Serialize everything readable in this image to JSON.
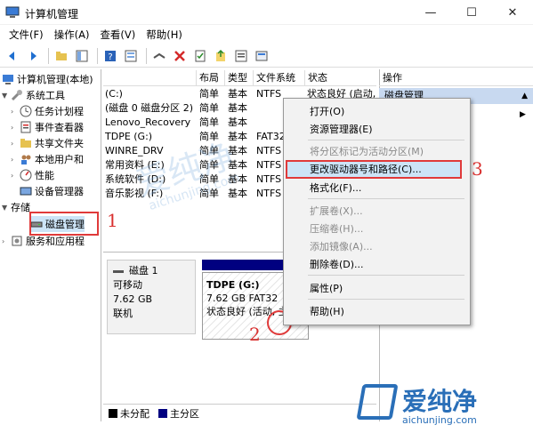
{
  "window": {
    "title": "计算机管理",
    "controls": {
      "minimize": "—",
      "maximize": "☐",
      "close": "✕"
    }
  },
  "menubar": [
    "文件(F)",
    "操作(A)",
    "查看(V)",
    "帮助(H)"
  ],
  "toolbar": {
    "icons": [
      "back-icon",
      "forward-icon",
      "folder-up-icon",
      "show-tree-icon",
      "help-icon",
      "properties-icon",
      "connect-icon",
      "delete-icon",
      "checklist-icon",
      "export-icon",
      "search-icon",
      "zoom-icon"
    ]
  },
  "tree": {
    "root": "计算机管理(本地)",
    "system_tools": "系统工具",
    "task_scheduler": "任务计划程",
    "event_viewer": "事件查看器",
    "shared_folders": "共享文件夹",
    "local_users": "本地用户和",
    "performance": "性能",
    "device_manager": "设备管理器",
    "storage": "存储",
    "disk_management": "磁盘管理",
    "services": "服务和应用程"
  },
  "volume_table": {
    "headers": {
      "layout": "布局",
      "type": "类型",
      "fs": "文件系统",
      "status": "状态"
    },
    "rows": [
      {
        "name": "(C:)",
        "layout": "简单",
        "type": "基本",
        "fs": "NTFS",
        "status": "状态良好 (启动,"
      },
      {
        "name": "(磁盘 0 磁盘分区 2)",
        "layout": "简单",
        "type": "基本",
        "fs": "",
        "status": ""
      },
      {
        "name": "Lenovo_Recovery",
        "layout": "简单",
        "type": "基本",
        "fs": "",
        "status": ""
      },
      {
        "name": "TDPE (G:)",
        "layout": "简单",
        "type": "基本",
        "fs": "FAT32",
        "status": ""
      },
      {
        "name": "WINRE_DRV",
        "layout": "简单",
        "type": "基本",
        "fs": "NTFS",
        "status": ""
      },
      {
        "name": "常用资料 (E:)",
        "layout": "简单",
        "type": "基本",
        "fs": "NTFS",
        "status": ""
      },
      {
        "name": "系统软件 (D:)",
        "layout": "简单",
        "type": "基本",
        "fs": "NTFS",
        "status": ""
      },
      {
        "name": "音乐影视 (F:)",
        "layout": "简单",
        "type": "基本",
        "fs": "NTFS",
        "status": ""
      }
    ]
  },
  "disk": {
    "name": "磁盘 1",
    "kind": "可移动",
    "size": "7.62 GB",
    "state": "联机",
    "partition_title": "TDPE  (G:)",
    "partition_size": "7.62 GB FAT32",
    "partition_status": "状态良好 (活动, 主"
  },
  "legend": {
    "unallocated": "未分配",
    "primary": "主分区"
  },
  "actions": {
    "header": "操作",
    "sub": "磁盘管理"
  },
  "context_menu": {
    "open": "打开(O)",
    "explorer": "资源管理器(E)",
    "mark_active": "将分区标记为活动分区(M)",
    "change_letter": "更改驱动器号和路径(C)...",
    "format": "格式化(F)...",
    "extend": "扩展卷(X)...",
    "shrink": "压缩卷(H)...",
    "add_mirror": "添加镜像(A)...",
    "delete": "删除卷(D)...",
    "properties": "属性(P)",
    "help": "帮助(H)"
  },
  "annotations": {
    "n1": "1",
    "n2": "2",
    "n3": "3"
  },
  "watermark": {
    "cn": "爱纯净",
    "url": "aichunjing.com"
  },
  "colors": {
    "annotation_red": "#e03a3a",
    "partition_blue": "#000080",
    "highlight": "#cce4f7"
  }
}
